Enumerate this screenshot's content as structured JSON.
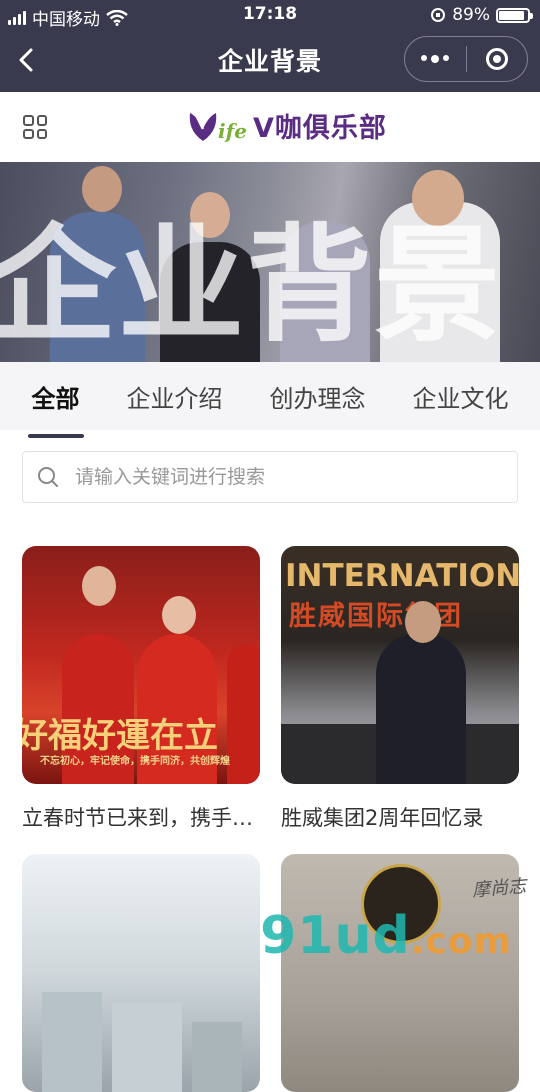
{
  "status_bar": {
    "carrier": "中国移动",
    "time": "17:18",
    "battery_text": "89%",
    "battery_level": 0.89
  },
  "nav": {
    "title": "企业背景"
  },
  "header": {
    "logo_letter": "V",
    "logo_suffix": "ife",
    "logo_text": "V咖俱乐部"
  },
  "banner": {
    "overlay_text": "企业背景"
  },
  "tabs": [
    {
      "label": "全部",
      "active": true
    },
    {
      "label": "企业介绍",
      "active": false
    },
    {
      "label": "创办理念",
      "active": false
    },
    {
      "label": "企业文化",
      "active": false
    }
  ],
  "search": {
    "placeholder": "请输入关键词进行搜索"
  },
  "cards": [
    {
      "caption": "立春时节已来到，携手同济，共创辉煌",
      "thumb_text": "好福好運在立",
      "thumb_subtext": "不忘初心，牢记使命，携手同济，共创辉煌"
    },
    {
      "caption": "胜威集团2周年回忆录",
      "thumb_text": "INTERNATION",
      "thumb_subtext": "胜威国际集团"
    },
    {
      "caption": ""
    },
    {
      "caption": ""
    }
  ],
  "watermark": {
    "text": "91ud",
    "suffix": ".com",
    "signature": "摩尚志"
  },
  "colors": {
    "nav_bg": "#3a3a4f",
    "brand_purple": "#5b2c83",
    "brand_green": "#7ab03a"
  },
  "icons": [
    "signal-icon",
    "wifi-icon",
    "back-arrow-icon",
    "more-dots-icon",
    "close-target-icon",
    "grid-menu-icon",
    "search-icon"
  ]
}
